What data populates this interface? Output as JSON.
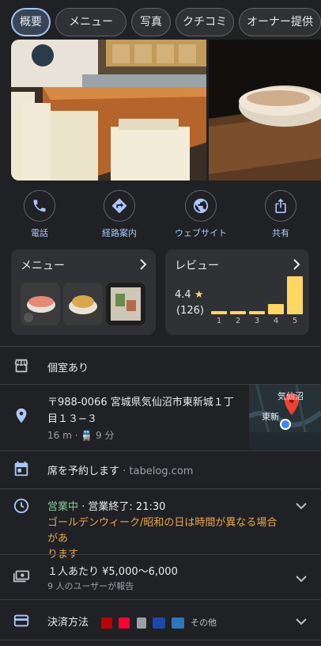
{
  "tabs": [
    "概要",
    "メニュー",
    "写真",
    "クチコミ",
    "オーナー提供"
  ],
  "actions": [
    {
      "label": "電話",
      "icon": "phone-icon"
    },
    {
      "label": "経路案内",
      "icon": "directions-icon"
    },
    {
      "label": "ウェブサイト",
      "icon": "globe-icon"
    },
    {
      "label": "共有",
      "icon": "share-icon"
    }
  ],
  "menu_card": {
    "title": "メニュー"
  },
  "review_card": {
    "title": "レビュー",
    "rating": "4.4",
    "count": "(126)",
    "distribution": [
      {
        "stars": "1",
        "share": 0.05
      },
      {
        "stars": "2",
        "share": 0.05
      },
      {
        "stars": "3",
        "share": 0.05
      },
      {
        "stars": "4",
        "share": 0.18
      },
      {
        "stars": "5",
        "share": 0.67
      }
    ]
  },
  "private_room": "個室あり",
  "address": {
    "line1": "〒988-0066 宮城県気仙沼市東新城１丁",
    "line2": "目１３−３",
    "distance": "16 m",
    "walk": "9 分",
    "map_label1": "気仙沼",
    "map_label2": "東新"
  },
  "reservation": {
    "text": "席を予約します",
    "source": "· tabelog.com"
  },
  "hours": {
    "status": "営業中",
    "closing": "· 営業終了: 21:30",
    "notice_line1": "ゴールデンウィーク/昭和の日は時間が異なる場合があ",
    "notice_line2": "ります"
  },
  "price": {
    "text": "１人あたり ¥5,000〜6,000",
    "sub": "9 人のユーザーが報告"
  },
  "payment": {
    "label": "決済方法",
    "other": "その他"
  },
  "colors": {
    "accent": "#a8c7fa",
    "open": "#81c995",
    "notice": "#e8a84c",
    "star": "#fdd663"
  }
}
